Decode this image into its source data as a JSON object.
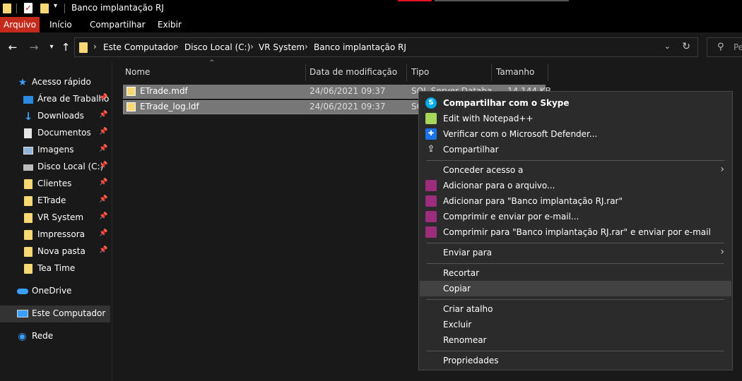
{
  "window": {
    "title": "Banco implantação RJ"
  },
  "ribbon": {
    "tabs": [
      "Arquivo",
      "Início",
      "Compartilhar",
      "Exibir"
    ]
  },
  "address": {
    "crumbs": [
      "Este Computador",
      "Disco Local (C:)",
      "VR System",
      "Banco implantação RJ"
    ],
    "search_placeholder": "Pe"
  },
  "nav": {
    "items": [
      {
        "label": "Acesso rápido",
        "icon": "star-icon"
      },
      {
        "label": "Área de Trabalho",
        "icon": "desktop-icon",
        "pinned": true
      },
      {
        "label": "Downloads",
        "icon": "download-icon",
        "pinned": true
      },
      {
        "label": "Documentos",
        "icon": "document-icon",
        "pinned": true
      },
      {
        "label": "Imagens",
        "icon": "image-icon",
        "pinned": true
      },
      {
        "label": "Disco Local (C:)",
        "icon": "drive-icon",
        "pinned": true
      },
      {
        "label": "Clientes",
        "icon": "folder-icon",
        "pinned": true
      },
      {
        "label": "ETrade",
        "icon": "folder-icon",
        "pinned": true
      },
      {
        "label": "VR System",
        "icon": "folder-icon",
        "pinned": true
      },
      {
        "label": "Impressora",
        "icon": "folder-icon",
        "pinned": true
      },
      {
        "label": "Nova pasta",
        "icon": "folder-icon",
        "pinned": true
      },
      {
        "label": "Tea Time",
        "icon": "folder-icon",
        "pinned": false
      },
      {
        "label": "OneDrive",
        "icon": "cloud-icon"
      },
      {
        "label": "Este Computador",
        "icon": "computer-icon",
        "selected": true
      },
      {
        "label": "Rede",
        "icon": "network-icon"
      }
    ]
  },
  "columns": [
    "Nome",
    "Data de modificação",
    "Tipo",
    "Tamanho"
  ],
  "files": [
    {
      "name": "ETrade.mdf",
      "date": "24/06/2021 09:37",
      "type": "SQL Server Databa",
      "size": "14.144 KB"
    },
    {
      "name": "ETrade_log.ldf",
      "date": "24/06/2021 09:37",
      "type": "SQ",
      "size": ""
    }
  ],
  "context_menu": {
    "items": [
      {
        "label": "Compartilhar com o Skype",
        "icon": "skype-icon",
        "bold": true
      },
      {
        "label": "Edit with Notepad++",
        "icon": "notepad-icon"
      },
      {
        "label": "Verificar com o Microsoft Defender...",
        "icon": "defender-icon"
      },
      {
        "label": "Compartilhar",
        "icon": "share-icon"
      },
      {
        "label": "Conceder acesso a",
        "submenu": true
      },
      {
        "label": "Adicionar para o arquivo...",
        "icon": "winrar-icon"
      },
      {
        "label": "Adicionar para \"Banco implantação RJ.rar\"",
        "icon": "winrar-icon"
      },
      {
        "label": "Comprimir e enviar por e-mail...",
        "icon": "winrar-icon"
      },
      {
        "label": "Comprimir para \"Banco implantação RJ.rar\" e enviar por e-mail",
        "icon": "winrar-icon"
      },
      {
        "label": "Enviar para",
        "submenu": true
      },
      {
        "label": "Recortar"
      },
      {
        "label": "Copiar",
        "hover": true
      },
      {
        "label": "Criar atalho"
      },
      {
        "label": "Excluir"
      },
      {
        "label": "Renomear"
      },
      {
        "label": "Propriedades"
      }
    ]
  },
  "colors": {
    "accent_file_tab": "#c42b1c",
    "folder": "#f8d775",
    "background": "#191919"
  }
}
